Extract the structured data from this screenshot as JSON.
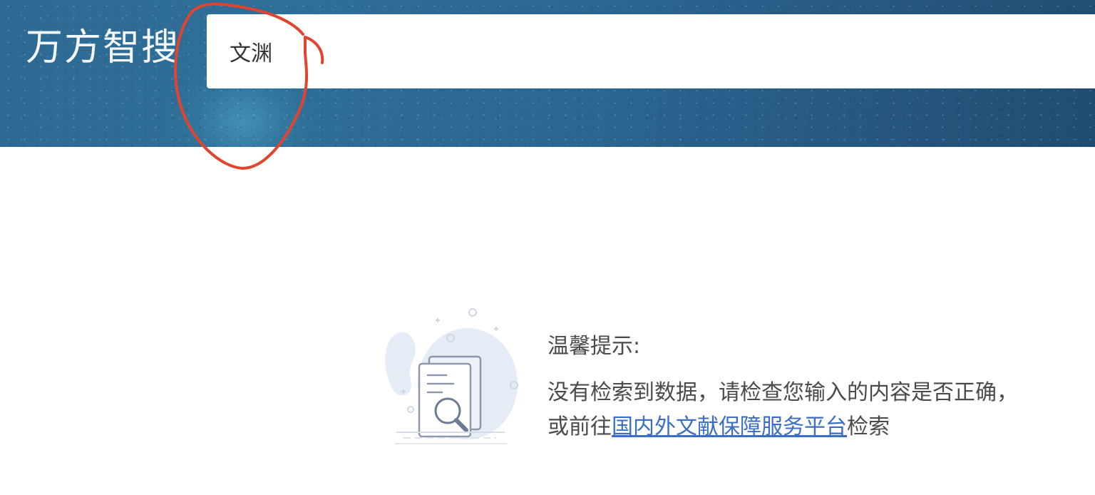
{
  "header": {
    "logo_text": "万方智搜",
    "background_color": "#2c6690"
  },
  "search": {
    "query": "文渊"
  },
  "empty_state": {
    "title": "温馨提示:",
    "message_line1": "没有检索到数据，请检查您输入的内容是否正确，",
    "message_line2_prefix": "或前往",
    "link_text": "国内外文献保障服务平台",
    "message_line2_suffix": "检索",
    "link_color": "#3a6ec4"
  },
  "annotation": {
    "color": "#e0452f"
  }
}
